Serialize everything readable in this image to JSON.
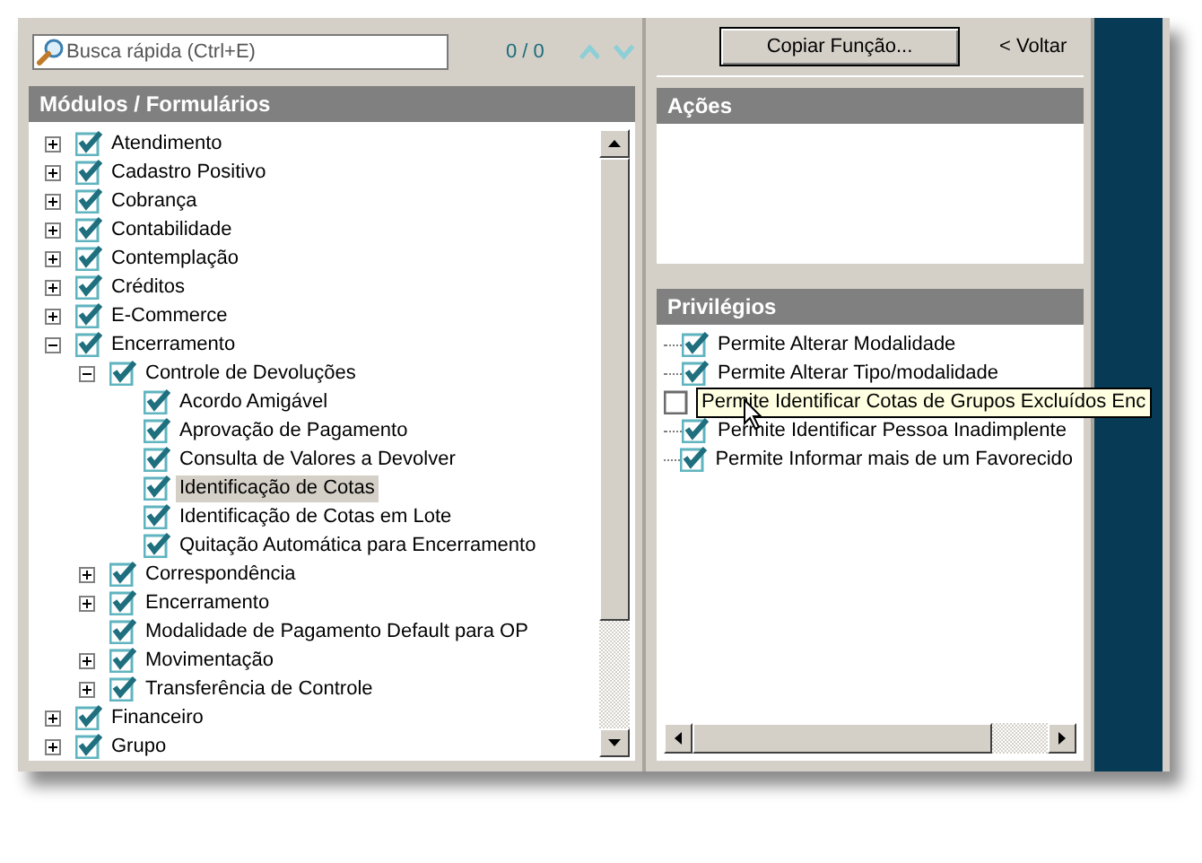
{
  "search": {
    "placeholder": "Busca rápida (Ctrl+E)",
    "count": "0 / 0"
  },
  "modules": {
    "title": "Módulos / Formulários",
    "tree": [
      {
        "label": "Atendimento",
        "checked": true,
        "expanded": false,
        "selected": false
      },
      {
        "label": "Cadastro Positivo",
        "checked": true,
        "expanded": false,
        "selected": false
      },
      {
        "label": "Cobrança",
        "checked": true,
        "expanded": false,
        "selected": false
      },
      {
        "label": "Contabilidade",
        "checked": true,
        "expanded": false,
        "selected": false
      },
      {
        "label": "Contemplação",
        "checked": true,
        "expanded": false,
        "selected": false
      },
      {
        "label": "Créditos",
        "checked": true,
        "expanded": false,
        "selected": false
      },
      {
        "label": "E-Commerce",
        "checked": true,
        "expanded": false,
        "selected": false
      },
      {
        "label": "Encerramento",
        "checked": true,
        "expanded": true,
        "selected": false,
        "children": [
          {
            "label": "Controle de Devoluções",
            "checked": true,
            "expanded": true,
            "selected": false,
            "children": [
              {
                "label": "Acordo Amigável",
                "checked": true,
                "selected": false
              },
              {
                "label": "Aprovação de Pagamento",
                "checked": true,
                "selected": false
              },
              {
                "label": "Consulta de Valores a Devolver",
                "checked": true,
                "selected": false
              },
              {
                "label": "Identificação de Cotas",
                "checked": true,
                "selected": true
              },
              {
                "label": "Identificação de Cotas em Lote",
                "checked": true,
                "selected": false
              },
              {
                "label": "Quitação Automática para Encerramento",
                "checked": true,
                "selected": false
              }
            ]
          },
          {
            "label": "Correspondência",
            "checked": true,
            "expanded": false,
            "selected": false
          },
          {
            "label": "Encerramento",
            "checked": true,
            "expanded": false,
            "selected": false
          },
          {
            "label": "Modalidade de Pagamento Default para OP",
            "checked": true,
            "selected": false
          },
          {
            "label": "Movimentação",
            "checked": true,
            "expanded": false,
            "selected": false
          },
          {
            "label": "Transferência de Controle",
            "checked": true,
            "expanded": false,
            "selected": false
          }
        ]
      },
      {
        "label": "Financeiro",
        "checked": true,
        "expanded": false,
        "selected": false
      },
      {
        "label": "Grupo",
        "checked": true,
        "expanded": false,
        "selected": false
      }
    ]
  },
  "copy_button": "Copiar Função...",
  "back_link": "< Voltar",
  "actions": {
    "title": "Ações"
  },
  "privileges": {
    "title": "Privilégios",
    "items": [
      {
        "label": "Permite Alterar Modalidade",
        "checked": true,
        "hovered": false
      },
      {
        "label": "Permite Alterar Tipo/modalidade",
        "checked": true,
        "hovered": false
      },
      {
        "label": "Permite Identificar Cotas de Grupos Excluídos Enc",
        "checked": false,
        "hovered": true
      },
      {
        "label": "Permite Identificar Pessoa Inadimplente",
        "checked": true,
        "hovered": false
      },
      {
        "label": "Permite Informar mais de um Favorecido",
        "checked": true,
        "hovered": false
      }
    ]
  }
}
